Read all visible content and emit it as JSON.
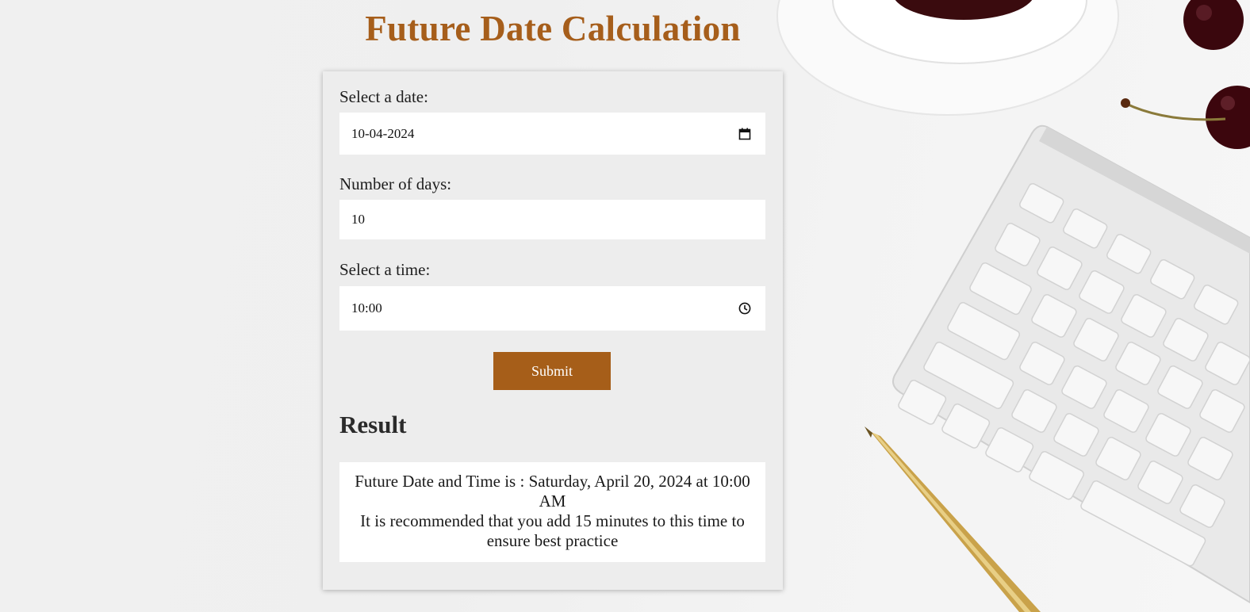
{
  "page": {
    "title": "Future Date Calculation"
  },
  "form": {
    "date": {
      "label": "Select a date:",
      "value": "10-04-2024",
      "icon": "calendar-icon"
    },
    "days": {
      "label": "Number of days:",
      "value": "10"
    },
    "time": {
      "label": "Select a time:",
      "value": "10:00",
      "icon": "clock-icon"
    },
    "submit_label": "Submit"
  },
  "result": {
    "heading": "Result",
    "line1": "Future Date and Time is : Saturday, April 20, 2024 at 10:00 AM",
    "line2": "It is recommended that you add 15 minutes to this time to ensure best practice"
  },
  "colors": {
    "accent": "#a65e1b",
    "button": "#a65e19",
    "card_bg": "#ececec",
    "input_bg": "#ffffff"
  }
}
